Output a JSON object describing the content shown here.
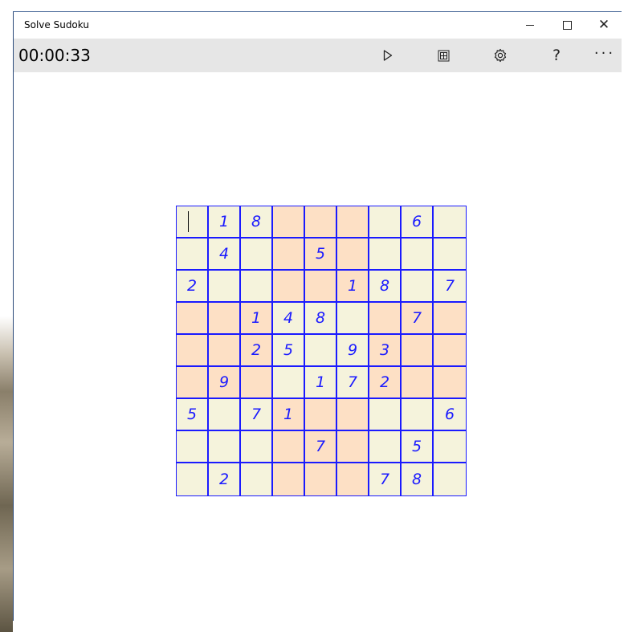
{
  "window": {
    "title": "Solve Sudoku",
    "minimize_icon": "minimize-icon",
    "maximize_icon": "maximize-icon",
    "close_icon": "close-icon",
    "close_glyph": "✕"
  },
  "toolbar": {
    "timer": "00:00:33",
    "play_icon": "play-icon",
    "grid_icon": "grid-icon",
    "settings_icon": "gear-icon",
    "help_glyph": "?",
    "more_glyph": "···"
  },
  "colors": {
    "grid_line": "#1a1aff",
    "digit": "#1a1aff",
    "light_box": "#f5f3dc",
    "dark_box": "#fde0c5",
    "appbar": "#e6e6e6"
  },
  "board": {
    "selected_cell": [
      0,
      0
    ],
    "grid": [
      [
        "",
        "1",
        "8",
        "",
        "",
        "",
        "",
        "6",
        ""
      ],
      [
        "",
        "4",
        "",
        "",
        "5",
        "",
        "",
        "",
        ""
      ],
      [
        "2",
        "",
        "",
        "",
        "",
        "1",
        "8",
        "",
        "7"
      ],
      [
        "",
        "",
        "1",
        "4",
        "8",
        "",
        "",
        "7",
        ""
      ],
      [
        "",
        "",
        "2",
        "5",
        "",
        "9",
        "3",
        "",
        ""
      ],
      [
        "",
        "9",
        "",
        "",
        "1",
        "7",
        "2",
        "",
        ""
      ],
      [
        "5",
        "",
        "7",
        "1",
        "",
        "",
        "",
        "",
        "6"
      ],
      [
        "",
        "",
        "",
        "",
        "7",
        "",
        "",
        "5",
        ""
      ],
      [
        "",
        "2",
        "",
        "",
        "",
        "",
        "7",
        "8",
        ""
      ]
    ]
  }
}
